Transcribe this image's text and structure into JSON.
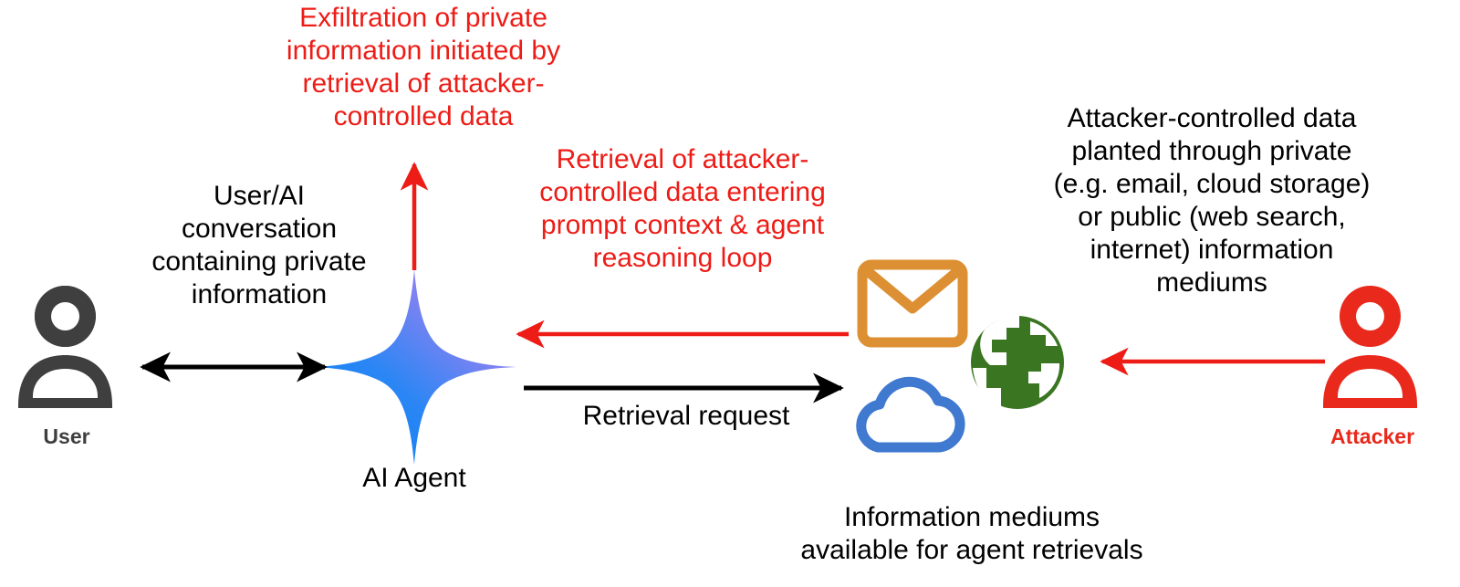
{
  "diagram": {
    "title": "AI agent private-information exfiltration via attacker-controlled data retrieval",
    "background_color": "#FFFFFF",
    "colors": {
      "red": "#ED1C16",
      "attacker_red": "#E8291B",
      "black": "#000000",
      "user_gray": "#3F3F3F",
      "agent_blue": "#1C86F2",
      "agent_purple": "#8F7BF0",
      "envelope_orange": "#DD9033",
      "cloud_blue": "#4079D0",
      "globe_green": "#3A7521"
    }
  },
  "notes": {
    "exfiltration": "Exfiltration of private\ninformation initiated by\nretrieval of attacker-\ncontrolled data",
    "retrieval_context": "Retrieval of attacker-\ncontrolled data entering\nprompt context & agent\nreasoning loop",
    "attacker_planted": "Attacker-controlled data\nplanted through private\n(e.g. email, cloud storage)\nor public (web search,\ninternet) information\nmediums",
    "user_conversation": "User/AI\nconversation\ncontaining private\ninformation"
  },
  "nodes": {
    "user": {
      "label": "User",
      "icon": "person-icon",
      "color": "#3F3F3F"
    },
    "ai_agent": {
      "label": "AI Agent",
      "icon": "sparkle-star-icon",
      "gradient_from": "#1C86F2",
      "gradient_to": "#8F7BF0"
    },
    "information_mediums": {
      "label": "Information mediums\navailable for agent retrievals",
      "icons": [
        {
          "name": "envelope-icon",
          "meaning": "email",
          "color": "#DD9033"
        },
        {
          "name": "cloud-icon",
          "meaning": "cloud storage",
          "color": "#4079D0"
        },
        {
          "name": "globe-icon",
          "meaning": "web / internet",
          "color": "#3A7521"
        }
      ]
    },
    "attacker": {
      "label": "Attacker",
      "icon": "person-icon",
      "color": "#E8291B"
    }
  },
  "edges": {
    "user_agent": {
      "label": "",
      "style": "double-headed",
      "color": "#000000",
      "annotation_ref": "user_conversation"
    },
    "agent_exfiltration": {
      "label": "",
      "style": "single-headed-up",
      "color": "#ED1C16",
      "annotation_ref": "exfiltration"
    },
    "mediums_to_agent": {
      "label": "",
      "style": "single-headed-left",
      "color": "#ED1C16",
      "annotation_ref": "retrieval_context"
    },
    "agent_to_mediums": {
      "label": "Retrieval request",
      "style": "single-headed-right",
      "color": "#000000"
    },
    "attacker_to_mediums": {
      "label": "",
      "style": "single-headed-left",
      "color": "#ED1C16",
      "annotation_ref": "attacker_planted"
    }
  }
}
